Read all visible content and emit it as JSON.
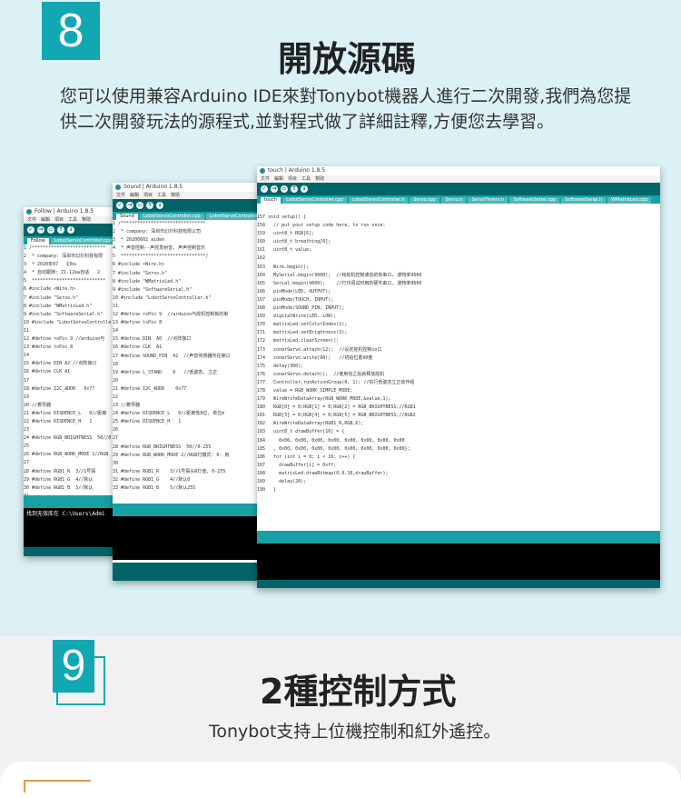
{
  "section8": {
    "number": "8",
    "title": "開放源碼",
    "description": "您可以使用兼容Arduino IDE來對Tonybot機器人進行二次開發,我們為您提供二次開發玩法的源程式,並對程式做了詳細註釋,方便您去學習。"
  },
  "section9": {
    "number": "9",
    "title": "2種控制方式",
    "subtitle": "Tonybot支持上位機控制和紅外遙控。"
  },
  "windows": {
    "back": {
      "title": "Follow | Arduino 1.8.5",
      "menu": [
        "文件",
        "編輯",
        "項目",
        "工具",
        "幫助"
      ],
      "tabs": [
        "Follow",
        "LobotServoController.cpp",
        "LobotServoController.h"
      ],
      "lines": [
        "1 /***************************",
        "2  * company: 深圳市幻尔科技有限",
        "3  * 2020年07   幻bu",
        "4  * 自动跟随: Z1-12kw自适   2",
        "5  ***************************",
        "6 #include <Wire.h>",
        "7 #include \"Servo.h\"",
        "8 #include \"WMatrixLed.h\"",
        "9 #include \"SoftwareSerial.h\"",
        "10 #include \"LobotServoControlle",
        "11",
        "12 #define rxPin 9 //arduino与",
        "13 #define txPin 8",
        "14",
        "15 #define DIN A2 //点阵接口",
        "16 #define CLK A1",
        "17",
        "18 #define I2C_ADDR   0x77",
        "19",
        "20 //着导器",
        "21 #define DISDENCE_L   0//距离",
        "22 #define DISDENCE_H   1",
        "23",
        "24 #define RGB_BRIGHTNESS  50//0",
        "25",
        "26 #define RGB_WORK_MODE 2//RGB",
        "27",
        "28 #define RGB1_R  3//1号探",
        "29 #define RGB1_G  4//默认",
        "30 #define RGB1_B  5//默认",
        "31",
        "32 #define RGB2_R  6//2号探",
        "33 #define RGB2_G  7//默认"
      ],
      "console": "找到无效库在 C:\\Users\\Admi"
    },
    "middle": {
      "title": "Sound | Arduino 1.8.5",
      "menu": [
        "文件",
        "編輯",
        "項目",
        "工具",
        "幫助"
      ],
      "tabs": [
        "Sound",
        "LobotServoController.cpp",
        "LobotServoController.h"
      ],
      "lines": [
        "1 /*******************************",
        "2  * company: 深圳市幻尔科技有限公司",
        "3  * 20200602 aiden",
        "4  * 声音控制--声控发射音, 声声控制音乐",
        "5  *******************************/",
        "6 #include <Wire.h>",
        "7 #include \"Servo.h\"",
        "8 #include \"WMatrixLed.h\"",
        "9 #include \"SoftwareSerial.h\"",
        "10 #include \"LobotServoController.h\"",
        "11",
        "12 #define rxPin 9  //arduino与舵机控制板的串",
        "13 #define txPin 8",
        "14",
        "15 #define DIN  A0  //点阵接口",
        "16 #define CLK  A1",
        "17 #define SOUND_PIN  A2  //声音传感器所在接口",
        "18",
        "19 #define L_STAND    0   //低姿态, 立正",
        "20",
        "21 #define I2C_ADDR    0x77",
        "22",
        "23 //着导器",
        "24 #define DISDENCE_L   0//距离低8位, 单位m",
        "25 #define DISDENCE_H   1",
        "26",
        "27",
        "28 #define RGB_BRIGHTNESS  50//0-255",
        "29 #define RGB_WORK_MODE 2//RGB灯模式: 0: 用",
        "30",
        "31 #define RGB1_R    3//1号探头R灯值, 0-255",
        "32 #define RGB1_G    4//默认0",
        "33 #define RGB1_B    5//默认255"
      ]
    },
    "front": {
      "title": "touch | Arduino 1.8.5",
      "menu": [
        "文件",
        "編輯",
        "項目",
        "工具",
        "幫助"
      ],
      "tabs": [
        "touch",
        "LobotServoController.cpp",
        "LobotServoController.h",
        "Servo.cpp",
        "Servo.h",
        "ServoTimers.h",
        "SoftwareSerial.cpp",
        "SoftwareSerial.h",
        "WMatrixLed.cpp"
      ],
      "lines": [
        "157 void setup() {",
        "158   // put your setup code here, to run once:",
        "159   uint8_t RGB[6];",
        "160   uint8_t breathing[6];",
        "161   uint8_t value;",
        "162",
        "163   Wire.begin();",
        "164   MySerial.begin(9600);  //和舵机控制通信的软串口, 波特率9600",
        "165   Serial.begin(9600);    //打印调试时用的硬件串口, 波特率9600",
        "166   pinMode(LED, OUTPUT);",
        "167   pinMode(TOUCH, INPUT);",
        "168   pinMode(SOUND_PIN, INPUT);",
        "169   digitalWrite(LED, LOW);",
        "170   matrixLed.setColorIndex(1);",
        "171   matrixLed.setBrightness(3);",
        "172   matrixLed.clearScreen();",
        "173   sonarServo.attach(12);  //设定舵机控制io口",
        "174   sonarServo.write(90);   //初始位置90度",
        "175   delay(300);",
        "176   sonarServo.detach();  //使用完之后就释放舵机",
        "177   Controller.runActionGroup(0, 1); //执行低姿态立正动作组",
        "178   value = RGB_WORK_SIMPLE_MODE;",
        "179   WireWriteDataArray(RGB_WORK_MODE,&value,1);",
        "180   RGB[0] = 0;RGB[1] = 0;RGB[2] = RGB_BRIGHTNESS;//RGB1",
        "181   RGB[3] = 0;RGB[4] = 0;RGB[5] = RGB_BRIGHTNESS;//RGB2",
        "182   WireWriteDataArray(RGB1_R,RGB,6);",
        "183   uint8_t drawBuffer[16] = {",
        "184     0x00, 0x00, 0x00, 0x00, 0x00, 0x00, 0x00, 0x00",
        "185   , 0x00, 0x00, 0x00, 0x00, 0x00, 0x00, 0x00, 0x00};",
        "186   for (int i = 0; i < 16; i++) {",
        "187     drawBuffer[i] = 0xff;",
        "188     matrixLed.drawBitmap(0,0,16,drawBuffer);",
        "189     delay(20);",
        "190   }"
      ]
    }
  },
  "colors": {
    "teal": "#12a8b3",
    "ide_dark": "#006468",
    "ide_tabs": "#17a1a5",
    "section8_bg": "#dbf1f6",
    "section9_bg": "#f1f1f1",
    "accent_orange": "#e49a4e"
  }
}
